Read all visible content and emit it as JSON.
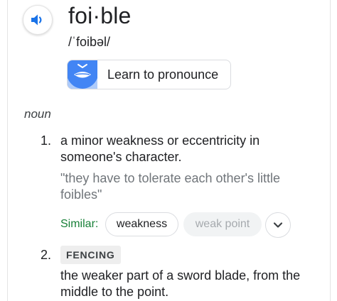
{
  "entry": {
    "word": "foi·ble",
    "phonetic": "/ˈfoibəl/",
    "learn_label": "Learn to pronounce",
    "part_of_speech": "noun"
  },
  "definitions": [
    {
      "number": "1.",
      "text_lines": [
        "a minor weakness or eccentricity in",
        "someone's character."
      ],
      "example_lines": [
        "\"they have to tolerate each other's little",
        "foibles\""
      ],
      "similar_label": "Similar:",
      "similar": [
        "weakness",
        "weak point"
      ]
    },
    {
      "number": "2.",
      "label": "FENCING",
      "text_lines": [
        "the weaker part of a sword blade, from the",
        "middle to the point."
      ]
    }
  ],
  "icons": {
    "speaker": "speaker-icon",
    "mouth": "mouth-icon",
    "expand": "chevron-down-icon"
  },
  "colors": {
    "speaker_blue": "#1a73e8",
    "mouth_bg": "#4285f4",
    "similar_green": "#188038",
    "example_gray": "#70757a"
  }
}
